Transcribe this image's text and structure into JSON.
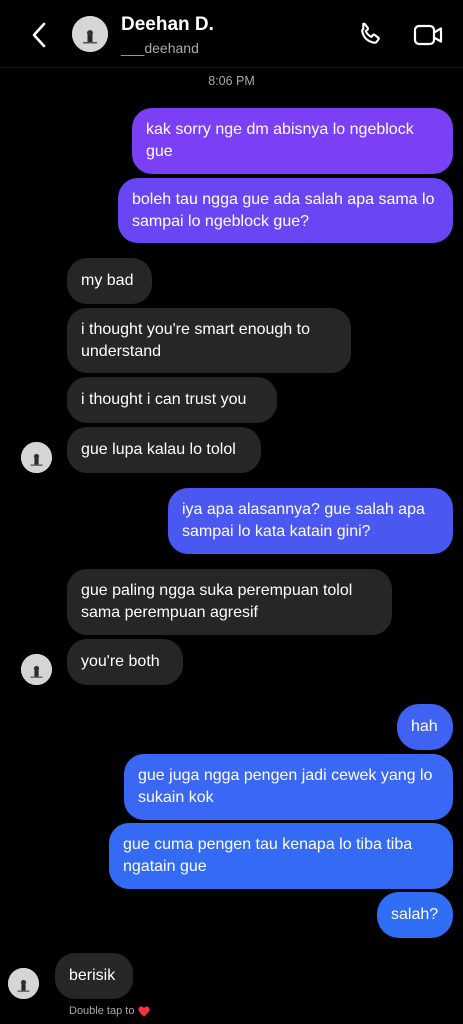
{
  "header": {
    "name": "Deehan D.",
    "username": "___deehand"
  },
  "timestamp": "8:06 PM",
  "messages": [
    {
      "from": "me",
      "text": "kak sorry nge dm abisnya lo ngeblock gue"
    },
    {
      "from": "me",
      "text": "boleh tau ngga gue ada salah apa sama lo sampai lo ngeblock gue?"
    },
    {
      "from": "them",
      "text": "my bad"
    },
    {
      "from": "them",
      "text": "i thought you're smart enough to understand"
    },
    {
      "from": "them",
      "text": "i thought i can trust you"
    },
    {
      "from": "them",
      "text": "gue lupa kalau lo tolol"
    },
    {
      "from": "me",
      "text": "iya apa alasannya? gue salah apa sampai lo kata katain gini?"
    },
    {
      "from": "them",
      "text": "gue paling ngga suka perempuan tolol sama perempuan agresif"
    },
    {
      "from": "them",
      "text": "you're both"
    },
    {
      "from": "me",
      "text": "hah"
    },
    {
      "from": "me",
      "text": "gue juga ngga pengen jadi cewek yang lo sukain kok"
    },
    {
      "from": "me",
      "text": "gue cuma pengen tau kenapa lo tiba tiba ngatain gue"
    },
    {
      "from": "me",
      "text": "salah?"
    },
    {
      "from": "them",
      "text": "berisik"
    }
  ],
  "footer": {
    "hint": "Double tap to"
  },
  "icons": {
    "back": "chevron-left-icon",
    "call": "phone-icon",
    "video": "video-camera-icon",
    "heart": "heart-icon"
  },
  "colors": {
    "background": "#000000",
    "incoming_bubble": "#262626",
    "outgoing_top": "#7b3ff5",
    "outgoing_mid": "#4a57f0",
    "outgoing_bottom": "#2f6cf5",
    "heart": "#ff3040"
  }
}
